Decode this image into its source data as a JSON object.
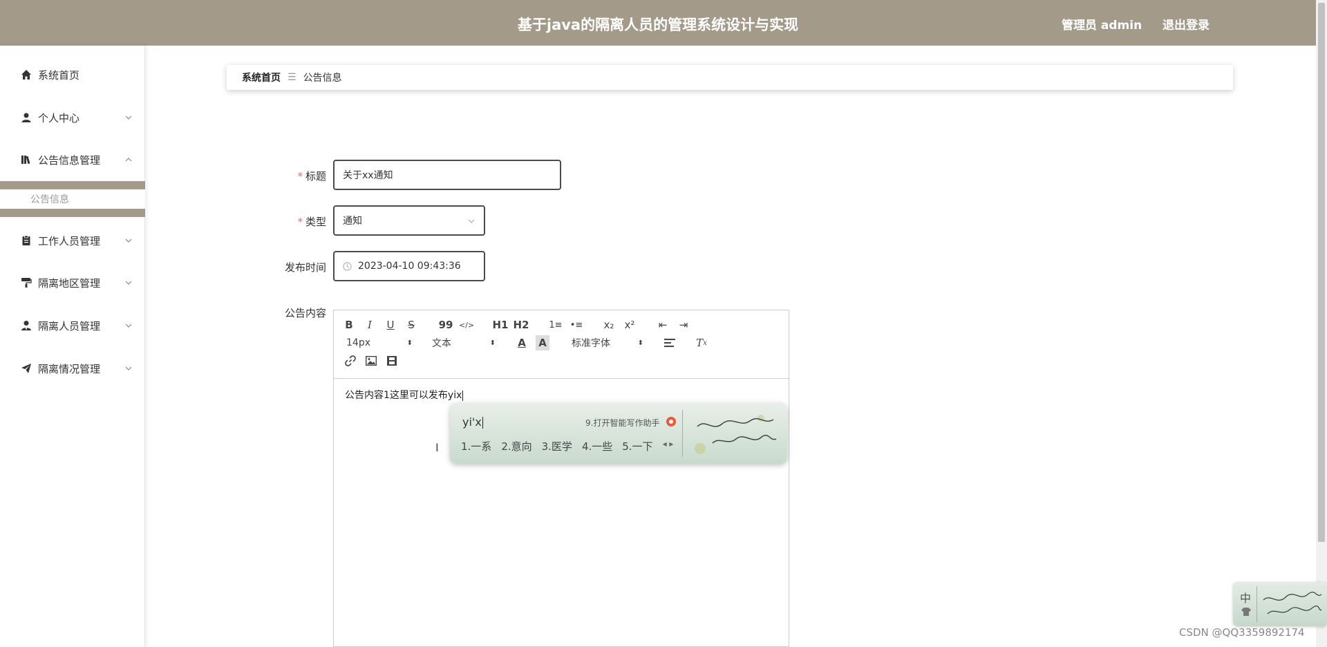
{
  "header": {
    "title": "基于java的隔离人员的管理系统设计与实现",
    "admin_label": "管理员 admin",
    "logout_label": "退出登录",
    "bg_color": "#a39a8a"
  },
  "sidebar": {
    "items": [
      {
        "label": "系统首页",
        "icon": "home-icon"
      },
      {
        "label": "个人中心",
        "icon": "user-icon"
      },
      {
        "label": "公告信息管理",
        "icon": "book-icon"
      },
      {
        "label": "工作人员管理",
        "icon": "clipboard-icon"
      },
      {
        "label": "隔离地区管理",
        "icon": "paint-roller-icon"
      },
      {
        "label": "隔离人员管理",
        "icon": "user-tie-icon"
      },
      {
        "label": "隔离情况管理",
        "icon": "paper-plane-icon"
      }
    ],
    "sub_item": "公告信息"
  },
  "breadcrumb": {
    "home": "系统首页",
    "separator": "☰",
    "current": "公告信息"
  },
  "form": {
    "title_label": "标题",
    "title_value": "关于xx通知",
    "type_label": "类型",
    "type_value": "通知",
    "time_label": "发布时间",
    "time_value": "2023-04-10 09:43:36",
    "content_label": "公告内容",
    "required_mark": "*"
  },
  "editor": {
    "toolbar_row1": [
      "B",
      "I",
      "U",
      "S",
      "99",
      "</>",
      "H1",
      "H2",
      "1≡",
      "•≡",
      "x₂",
      "x²",
      "⇤",
      "⇥"
    ],
    "font_size": "14px",
    "text_type": "文本",
    "font_family": "标准字体",
    "content": "公告内容1这里可以发布yix"
  },
  "ime": {
    "pinyin": "yi'x",
    "assist": "9.打开智能写作助手",
    "candidates": [
      "1.一系",
      "2.意向",
      "3.医学",
      "4.一些",
      "5.一下"
    ],
    "mini_label": "中"
  },
  "watermark": "CSDN @QQ3359892174"
}
